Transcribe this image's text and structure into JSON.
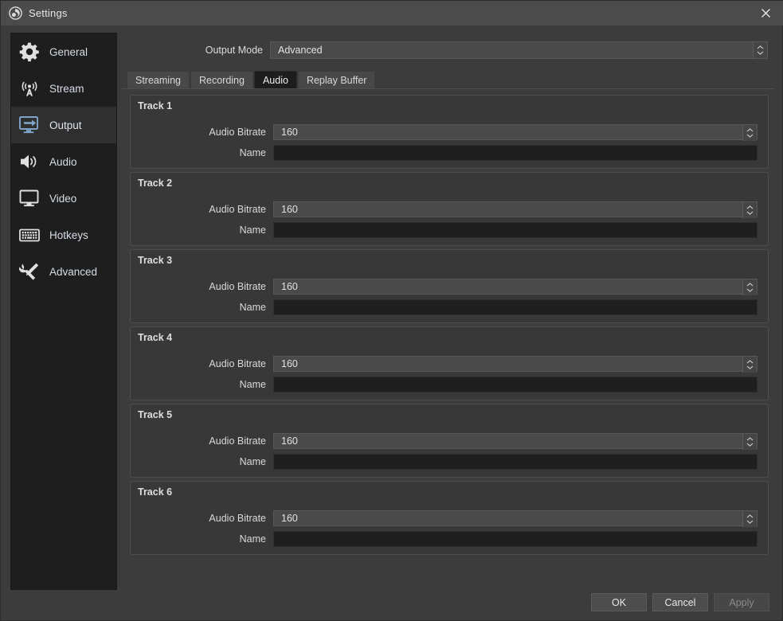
{
  "window": {
    "title": "Settings",
    "logo_icon": "obs-logo-icon",
    "close_icon": "close-icon"
  },
  "sidebar": {
    "items": [
      {
        "label": "General",
        "icon": "gear-icon",
        "selected": false
      },
      {
        "label": "Stream",
        "icon": "broadcast-icon",
        "selected": false
      },
      {
        "label": "Output",
        "icon": "monitor-arrow-icon",
        "selected": true
      },
      {
        "label": "Audio",
        "icon": "speaker-icon",
        "selected": false
      },
      {
        "label": "Video",
        "icon": "monitor-icon",
        "selected": false
      },
      {
        "label": "Hotkeys",
        "icon": "keyboard-icon",
        "selected": false
      },
      {
        "label": "Advanced",
        "icon": "tools-icon",
        "selected": false
      }
    ]
  },
  "output_mode": {
    "label": "Output Mode",
    "value": "Advanced",
    "spinner_icon": "spinner-updown-icon"
  },
  "tabs": [
    {
      "label": "Streaming",
      "active": false
    },
    {
      "label": "Recording",
      "active": false
    },
    {
      "label": "Audio",
      "active": true
    },
    {
      "label": "Replay Buffer",
      "active": false
    }
  ],
  "field_labels": {
    "audio_bitrate": "Audio Bitrate",
    "name": "Name"
  },
  "name_placeholder": "",
  "tracks": [
    {
      "title": "Track 1",
      "audio_bitrate": "160",
      "name": ""
    },
    {
      "title": "Track 2",
      "audio_bitrate": "160",
      "name": ""
    },
    {
      "title": "Track 3",
      "audio_bitrate": "160",
      "name": ""
    },
    {
      "title": "Track 4",
      "audio_bitrate": "160",
      "name": ""
    },
    {
      "title": "Track 5",
      "audio_bitrate": "160",
      "name": ""
    },
    {
      "title": "Track 6",
      "audio_bitrate": "160",
      "name": ""
    }
  ],
  "footer": {
    "ok": "OK",
    "cancel": "Cancel",
    "apply": "Apply",
    "apply_disabled": true
  },
  "colors": {
    "window_bg": "#3c3c3c",
    "titlebar_bg": "#4b4b4b",
    "sidebar_bg": "#1e1e1e",
    "sidebar_selected_bg": "#2f2f2f",
    "accent_icon": "#7fa3c9",
    "group_bg": "#383838",
    "combo_bg": "#4a4a4a",
    "input_bg": "#1f1f1f",
    "text": "#e2e2e2"
  }
}
